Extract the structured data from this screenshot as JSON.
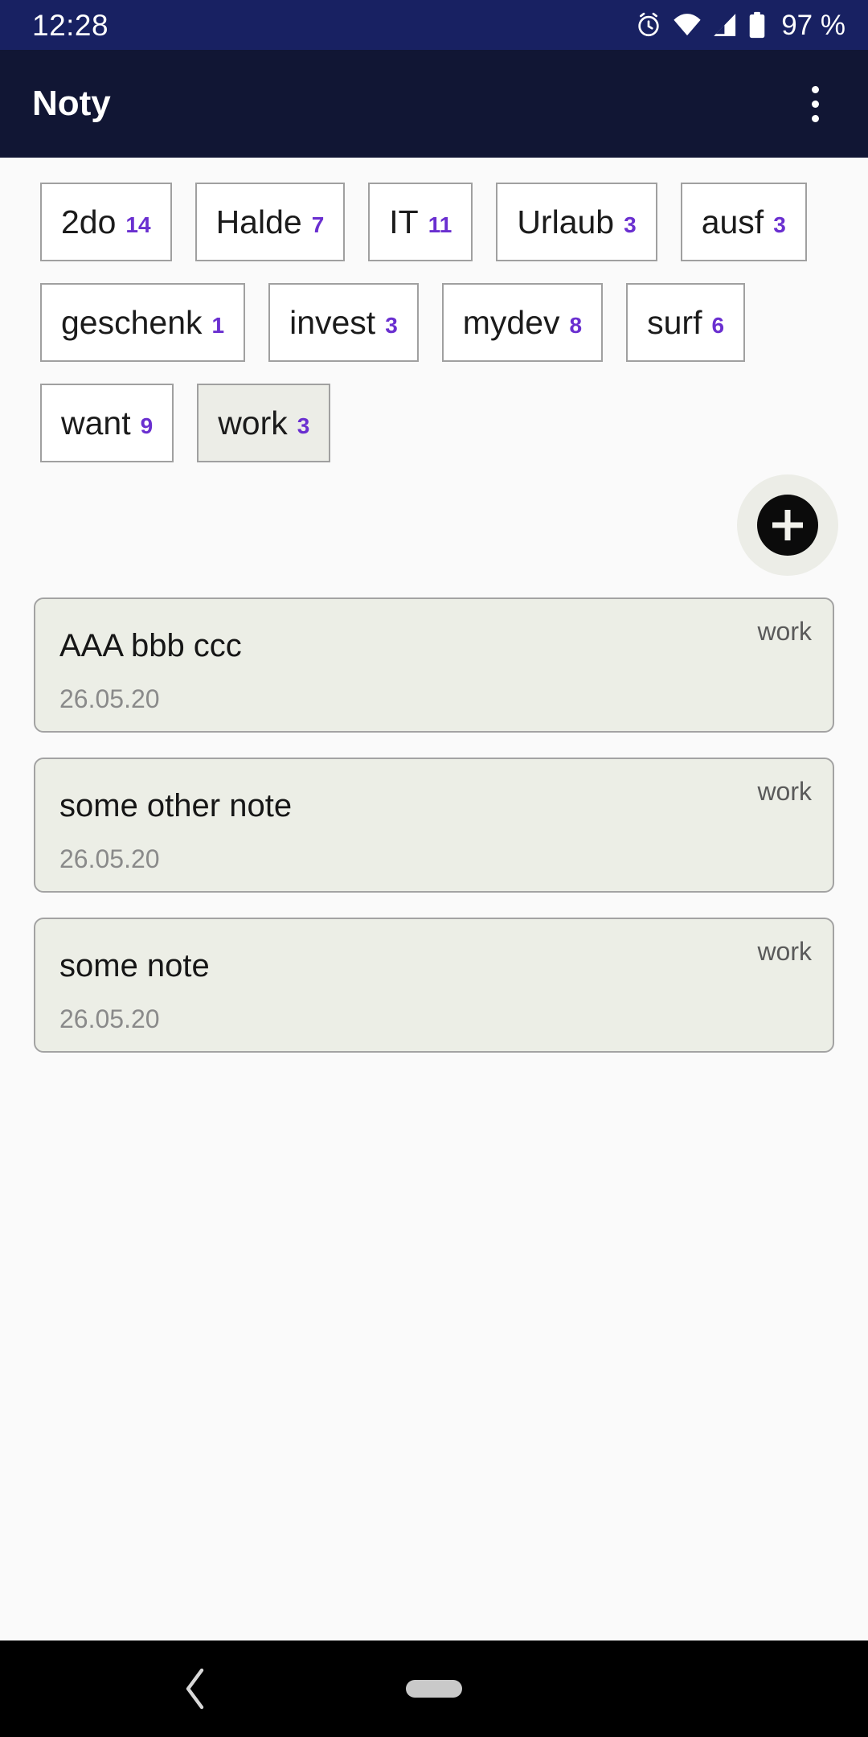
{
  "status_bar": {
    "clock": "12:28",
    "battery_percent": "97 %",
    "icons": [
      "alarm-icon",
      "wifi-icon",
      "cellular-signal-icon",
      "battery-icon"
    ],
    "background_color": "#182162"
  },
  "app_bar": {
    "title": "Noty",
    "overflow_menu_icon": "more-vert-icon",
    "background_color": "#111634"
  },
  "tags": {
    "accent_color": "#6A2FD0",
    "items": [
      {
        "label": "2do",
        "count": "14",
        "selected": false
      },
      {
        "label": "Halde",
        "count": "7",
        "selected": false
      },
      {
        "label": "IT",
        "count": "11",
        "selected": false
      },
      {
        "label": "Urlaub",
        "count": "3",
        "selected": false
      },
      {
        "label": "ausf",
        "count": "3",
        "selected": false
      },
      {
        "label": "geschenk",
        "count": "1",
        "selected": false
      },
      {
        "label": "invest",
        "count": "3",
        "selected": false
      },
      {
        "label": "mydev",
        "count": "8",
        "selected": false
      },
      {
        "label": "surf",
        "count": "6",
        "selected": false
      },
      {
        "label": "want",
        "count": "9",
        "selected": false
      },
      {
        "label": "work",
        "count": "3",
        "selected": true
      }
    ]
  },
  "fab": {
    "icon": "plus-icon"
  },
  "notes": [
    {
      "title": "AAA bbb ccc",
      "date": "26.05.20",
      "tag": "work"
    },
    {
      "title": "some other note",
      "date": "26.05.20",
      "tag": "work"
    },
    {
      "title": "some note",
      "date": "26.05.20",
      "tag": "work"
    }
  ],
  "nav_bar": {
    "back_icon": "back-chevron-icon",
    "home_icon": "home-pill-icon"
  }
}
